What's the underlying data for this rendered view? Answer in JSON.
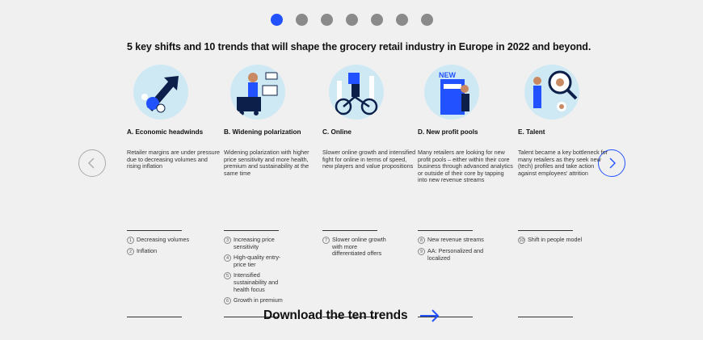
{
  "carousel": {
    "dot_count": 7,
    "active_index": 0,
    "accent": "#2251ff"
  },
  "headline": "5 key shifts and 10 trends that will shape the grocery retail industry in Europe in 2022 and beyond.",
  "columns": [
    {
      "title": "A. Economic headwinds",
      "description": "Retailer margins are under pressure due to decreasing volumes and rising inflation",
      "icon": "economic-headwinds-illustration",
      "trends": [
        {
          "num": "1",
          "label": "Decreasing volumes"
        },
        {
          "num": "2",
          "label": "Inflation"
        }
      ]
    },
    {
      "title": "B. Widening polarization",
      "description": "Widening polarization with higher price sensitivity and more health, premium and sustainability at the same time",
      "icon": "polarization-illustration",
      "trends": [
        {
          "num": "3",
          "label": "Increasing price sensitivity"
        },
        {
          "num": "4",
          "label": "High-quality entry-price tier"
        },
        {
          "num": "5",
          "label": "Intensified sustainability and health focus"
        },
        {
          "num": "6",
          "label": "Growth in premium"
        }
      ]
    },
    {
      "title": "C. Online",
      "description": "Slower online growth and intensified fight for online in terms of speed, new players and value propositions",
      "icon": "online-delivery-illustration",
      "trends": [
        {
          "num": "7",
          "label": "Slower online growth with more differentiated offers"
        }
      ]
    },
    {
      "title": "D. New profit pools",
      "description": "Many retailers are looking for new profit pools – either within their core business through advanced analytics or outside of their core by tapping into new revenue streams",
      "icon": "new-profit-pools-illustration",
      "trends": [
        {
          "num": "8",
          "label": "New revenue streams"
        },
        {
          "num": "9",
          "label": "AA: Personalized and localized"
        }
      ]
    },
    {
      "title": "E. Talent",
      "description": "Talent became a key bottleneck for many retailers as they seek new (tech) profiles and take action against employees' attrition",
      "icon": "talent-illustration",
      "trends": [
        {
          "num": "10",
          "label": "Shift in people model"
        }
      ]
    }
  ],
  "nav": {
    "prev_icon": "chevron-left-icon",
    "next_icon": "chevron-right-icon"
  },
  "download": {
    "label": "Download the ten trends",
    "icon": "arrow-right-icon"
  }
}
